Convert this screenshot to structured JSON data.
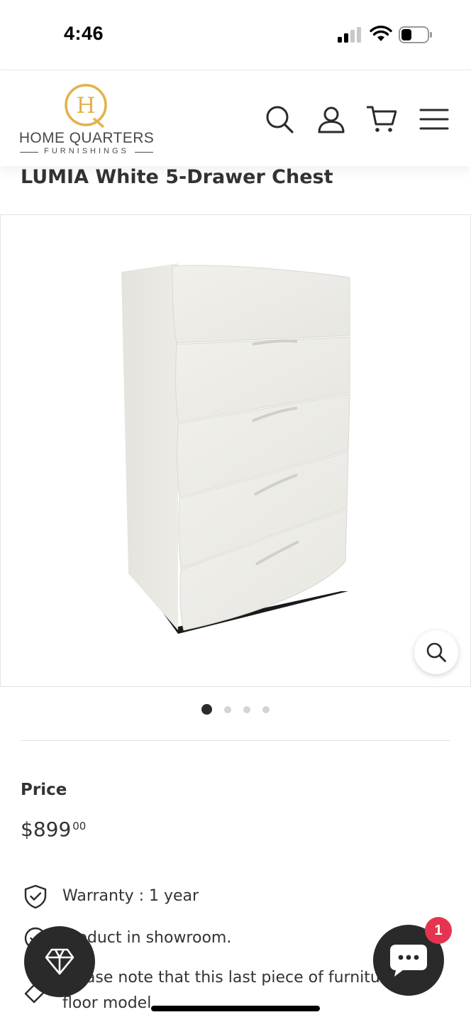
{
  "status_bar": {
    "time": "4:46",
    "icons": [
      "cellular-signal-icon",
      "wifi-icon",
      "battery-icon"
    ]
  },
  "header": {
    "logo": {
      "monogram": "HQ",
      "name": "HOME QUARTERS",
      "subtitle": "FURNISHINGS",
      "color": "#e3b14a"
    },
    "icons": [
      "search-icon",
      "account-icon",
      "cart-icon",
      "menu-icon"
    ]
  },
  "product": {
    "title": "LUMIA White 5-Drawer Chest",
    "image_icon": "dresser-product-image",
    "price_label": "Price",
    "price_main": "$899",
    "price_cents": "00",
    "features": [
      {
        "icon": "shield-check-icon",
        "text": "Warranty : 1 year"
      },
      {
        "icon": "check-circle-icon",
        "text": "Product in showroom."
      },
      {
        "icon": "tag-icon",
        "text": "Please note that this last piece of furniture is a",
        "text2": "floor model"
      }
    ]
  },
  "gallery": {
    "slide_count": 4,
    "active_slide": 1
  },
  "floating": {
    "rewards_icon": "diamond-icon",
    "chat_icon": "chat-bubble-icon",
    "chat_badge": "1"
  },
  "colors": {
    "accent": "#e3b14a",
    "dark": "#2a2a2a",
    "badge": "#e5344f"
  }
}
